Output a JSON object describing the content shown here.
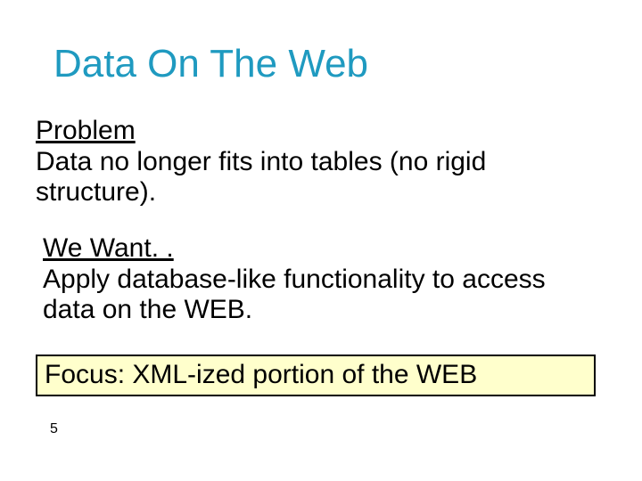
{
  "slide": {
    "title": "Data On The Web",
    "problem": {
      "heading": "Problem",
      "body": "Data no longer fits into tables (no rigid structure)."
    },
    "want": {
      "heading": "We Want. .",
      "body": "Apply database-like functionality to access data on the WEB."
    },
    "focus": "Focus: XML-ized portion of the WEB",
    "page_number": "5"
  }
}
